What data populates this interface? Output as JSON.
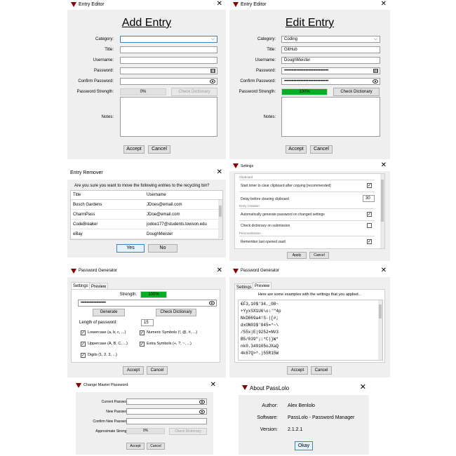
{
  "windows": {
    "add_entry": {
      "title": "Entry Editor",
      "heading": "Add Entry",
      "labels": {
        "category": "Category:",
        "title": "Title:",
        "username": "Username:",
        "password": "Password:",
        "confirm": "Confirm Password:",
        "strength": "Password Strength:",
        "notes": "Notes:"
      },
      "values": {
        "category": "",
        "title": "",
        "username": "",
        "password": "",
        "confirm": ""
      },
      "strength": {
        "text": "0%",
        "percent": 0
      },
      "check_dictionary": "Check Dictionary",
      "accept": "Accept",
      "cancel": "Cancel"
    },
    "edit_entry": {
      "title": "Entry Editor",
      "heading": "Edit Entry",
      "labels": {
        "category": "Category:",
        "title": "Title:",
        "username": "Username:",
        "password": "Password:",
        "confirm": "Confirm Password:",
        "strength": "Password Strength:",
        "notes": "Notes:"
      },
      "values": {
        "category": "Coding",
        "title": "GitHub",
        "username": "DoughMeister",
        "password": "•••••••••••••••••••••••••••••••••••••",
        "confirm": "•••••••••••••••••••••••••••••••••••••"
      },
      "strength": {
        "text": "100%",
        "percent": 100
      },
      "check_dictionary": "Check Dictionary",
      "accept": "Accept",
      "cancel": "Cancel"
    },
    "entry_remover": {
      "title": "Entry Remover",
      "prompt": "Are you sure you want to move the following entries to the recycling bin?",
      "columns": [
        "Title",
        "Username"
      ],
      "rows": [
        {
          "title": "Busch Gardens",
          "username": "JDoes@email.com"
        },
        {
          "title": "CharmPass",
          "username": "JDoe@email.com"
        },
        {
          "title": "CodeBreaker",
          "username": "jodoe177@students.towson.edu"
        },
        {
          "title": "eBay",
          "username": "DoughMeister"
        }
      ],
      "yes": "Yes",
      "no": "No"
    },
    "settings": {
      "title": "Settings",
      "groups": [
        {
          "name": "Clipboard",
          "items": [
            {
              "label": "Start timer to clear clipboard after copying [recommended]",
              "control": "checkbox",
              "checked": true
            },
            {
              "label": "Delay before clearing clipboard",
              "control": "spin",
              "value": "30"
            }
          ]
        },
        {
          "name": "Entry Creation",
          "items": [
            {
              "label": "Automatically generate password on changed settings",
              "control": "checkbox",
              "checked": true
            },
            {
              "label": "Check dictionary on submission",
              "control": "checkbox",
              "checked": false
            }
          ]
        },
        {
          "name": "Personalization",
          "items": [
            {
              "label": "Remember last opened vault",
              "control": "checkbox",
              "checked": true
            }
          ]
        }
      ],
      "apply": "Apply",
      "cancel": "Cancel"
    },
    "pw_gen_settings": {
      "title": "Password Generator",
      "tabs": [
        "Settings",
        "Preview"
      ],
      "strength_label": "Strength:",
      "strength": {
        "text": "100%",
        "percent": 100
      },
      "password": "•••••••••••••••••••••",
      "generate": "Generate",
      "check_dictionary": "Check Dictionary",
      "length_label": "Length of password:",
      "length_value": "15",
      "options": [
        {
          "label": "Lowercase (a, b, c, ...)",
          "checked": true
        },
        {
          "label": "Numeric Symbols (!, @, #, ...)",
          "checked": true
        },
        {
          "label": "Uppercase (A, B, C, ...)",
          "checked": true
        },
        {
          "label": "Extra Symbols (+, ?, ~, ...)",
          "checked": true
        },
        {
          "label": "Digits (1, 2, 3, ...)",
          "checked": true
        }
      ],
      "accept": "Accept",
      "cancel": "Cancel"
    },
    "pw_gen_preview": {
      "title": "Password Generator",
      "tabs": [
        "Settings",
        "Preview"
      ],
      "intro": "Here are some examples with the settings that you applied...",
      "examples": [
        "€F3,10$'34._08~",
        "+YyxSX1U6\\o:'\"4p",
        "NkD869a4!S-|[#;",
        "dxON03$'845=*~\\",
        "/55x|E|9252=NV3",
        "B5/039\";:*C|}W*",
        "nk0.349105oJXaQ",
        "4k67Q>^.)55R15W"
      ],
      "accept": "Accept",
      "cancel": "Cancel"
    },
    "change_master": {
      "title": "Change Master Password",
      "labels": {
        "current": "Current Password:",
        "new": "New Password:",
        "confirm": "Confirm New Password:",
        "strength": "Approximate Strength:"
      },
      "strength": {
        "text": "0%",
        "percent": 0
      },
      "check_dictionary": "Check Dictionary",
      "accept": "Accept",
      "cancel": "Cancel"
    },
    "about": {
      "title": "About PassLolo",
      "author_label": "Author:",
      "author": "Alex Benlolo",
      "software_label": "Software:",
      "software": "PassLolo - Password Manager",
      "version_label": "Version:",
      "version": "2.1.2.1",
      "okay": "Okay"
    }
  },
  "colors": {
    "strength_fill": "#06b025",
    "dialog_bg": "#efefef",
    "logo": "#8b0000",
    "focus": "#3b82c4"
  }
}
